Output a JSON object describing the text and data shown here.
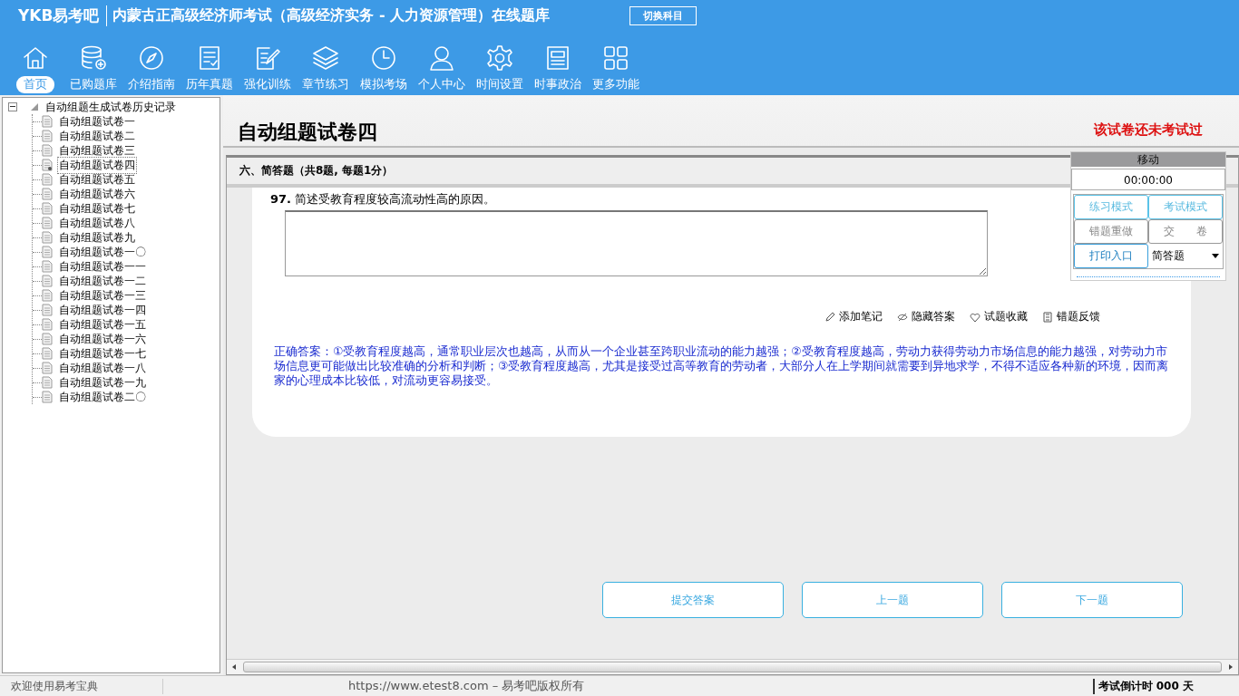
{
  "header": {
    "logo": "YKB易考吧",
    "title": "内蒙古正高级经济师考试（高级经济实务 - 人力资源管理）在线题库",
    "switch_button": "切换科目"
  },
  "toolbar": [
    {
      "label": "首页",
      "selected": true
    },
    {
      "label": "已购题库",
      "selected": false
    },
    {
      "label": "介绍指南",
      "selected": false
    },
    {
      "label": "历年真题",
      "selected": false
    },
    {
      "label": "强化训练",
      "selected": false
    },
    {
      "label": "章节练习",
      "selected": false
    },
    {
      "label": "模拟考场",
      "selected": false
    },
    {
      "label": "个人中心",
      "selected": false
    },
    {
      "label": "时间设置",
      "selected": false
    },
    {
      "label": "时事政治",
      "selected": false
    },
    {
      "label": "更多功能",
      "selected": false
    }
  ],
  "tree": {
    "label": "自动组题生成试卷历史记录",
    "expanded": true,
    "children": [
      {
        "label": "自动组题试卷一",
        "selected": false
      },
      {
        "label": "自动组题试卷二",
        "selected": false
      },
      {
        "label": "自动组题试卷三",
        "selected": false
      },
      {
        "label": "自动组题试卷四",
        "selected": true
      },
      {
        "label": "自动组题试卷五",
        "selected": false
      },
      {
        "label": "自动组题试卷六",
        "selected": false
      },
      {
        "label": "自动组题试卷七",
        "selected": false
      },
      {
        "label": "自动组题试卷八",
        "selected": false
      },
      {
        "label": "自动组题试卷九",
        "selected": false
      },
      {
        "label": "自动组题试卷一〇",
        "selected": false
      },
      {
        "label": "自动组题试卷一一",
        "selected": false
      },
      {
        "label": "自动组题试卷一二",
        "selected": false
      },
      {
        "label": "自动组题试卷一三",
        "selected": false
      },
      {
        "label": "自动组题试卷一四",
        "selected": false
      },
      {
        "label": "自动组题试卷一五",
        "selected": false
      },
      {
        "label": "自动组题试卷一六",
        "selected": false
      },
      {
        "label": "自动组题试卷一七",
        "selected": false
      },
      {
        "label": "自动组题试卷一八",
        "selected": false
      },
      {
        "label": "自动组题试卷一九",
        "selected": false
      },
      {
        "label": "自动组题试卷二〇",
        "selected": false
      }
    ]
  },
  "paper": {
    "title": "自动组题试卷四",
    "status": "该试卷还未考试过"
  },
  "section": "六、简答题（共8题, 每题1分）",
  "question": {
    "number": "97.",
    "text": "简述受教育程度较高流动性高的原因。"
  },
  "actions": [
    "添加笔记",
    "隐藏答案",
    "试题收藏",
    "错题反馈"
  ],
  "answer": "正确答案：①受教育程度越高，通常职业层次也越高，从而从一个企业甚至跨职业流动的能力越强；②受教育程度越高，劳动力获得劳动力市场信息的能力越强，对劳动力市场信息更可能做出比较准确的分析和判断；③受教育程度越高，尤其是接受过高等教育的劳动者，大部分人在上学期间就需要到异地求学，不得不适应各种新的环境，因而离家的心理成本比较低，对流动更容易接受。",
  "side_panel": {
    "header": "移动",
    "timer": "00:00:00",
    "buttons": [
      {
        "label": "练习模式",
        "kind": "active"
      },
      {
        "label": "考试模式",
        "kind": "active"
      },
      {
        "label": "错题重做",
        "kind": "plain"
      },
      {
        "label": "交　　卷",
        "kind": "plain"
      },
      {
        "label": "打印入口",
        "kind": "primary"
      }
    ],
    "type_select": "简答题"
  },
  "nav_buttons": [
    "提交答案",
    "上一题",
    "下一题"
  ],
  "status_bar": {
    "welcome": "欢迎使用易考宝典",
    "copyright": "https://www.etest8.com – 易考吧版权所有",
    "countdown": "考试倒计时 000 天"
  }
}
